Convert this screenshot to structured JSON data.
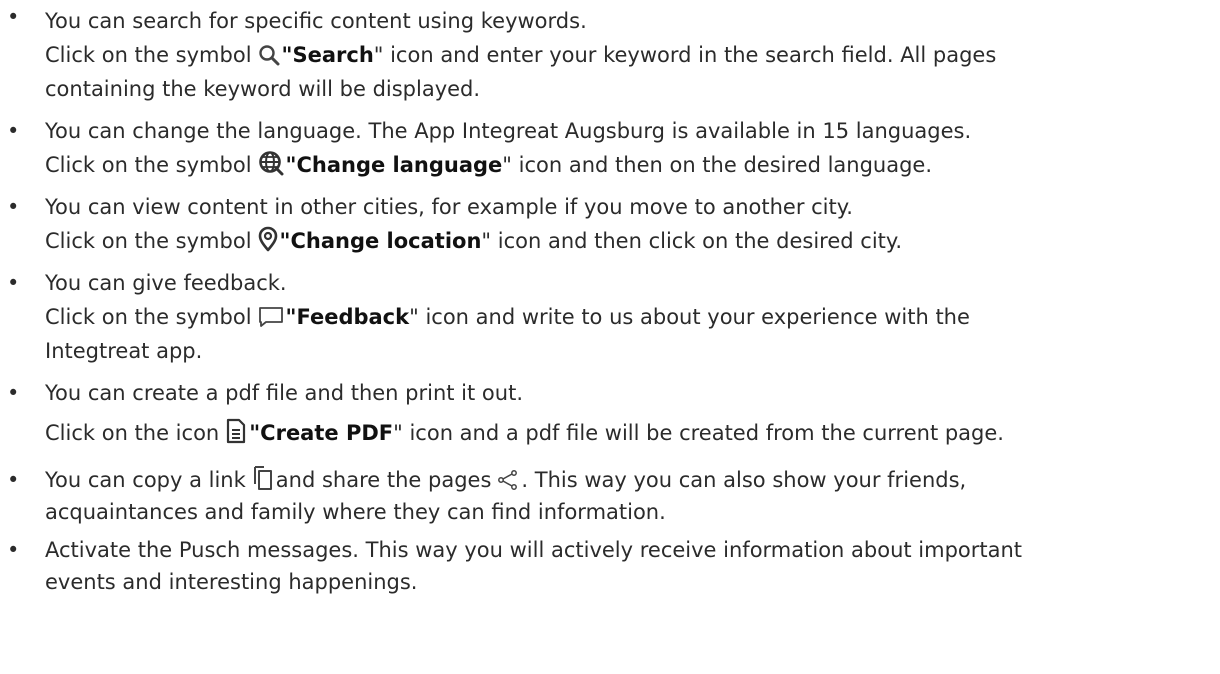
{
  "items": [
    {
      "intro": "You can search for specific content using keywords.",
      "pre": "Click on the symbol",
      "icon": "search-icon",
      "bold": "\"Search",
      "post": "\" icon and enter your keyword in the search field. All pages",
      "cont": "containing the keyword will be displayed."
    },
    {
      "intro": "You can change the language. The App Integreat Augsburg is available in 15 languages.",
      "pre": "Click on the symbol",
      "icon": "globe-icon",
      "bold": "\"Change language",
      "post": "\" icon and then on the desired language."
    },
    {
      "intro": "You can view content in other cities, for example if you move to another city.",
      "pre": "Click on the symbol",
      "icon": "location-pin-icon",
      "bold": "\"Change location",
      "post": "\" icon and then click on the desired city."
    },
    {
      "intro": "You can give feedback.",
      "pre": "Click on the symbol",
      "icon": "feedback-icon",
      "bold": "\"Feedback",
      "post": "\" icon and write to us about your experience with the",
      "cont": "Integtreat app."
    },
    {
      "intro": "You can create a pdf file and then print it out.",
      "pre": "Click on the icon",
      "icon": "document-icon",
      "bold": "\"Create PDF",
      "post": "\" icon and a pdf file will be created from the current page."
    },
    {
      "pre": "You can copy a link",
      "icon": "copy-icon",
      "mid": "and share the pages",
      "icon2": "share-icon",
      "post": ". This way you can also show your friends,",
      "cont": "acquaintances and family where they can find information."
    },
    {
      "intro": "Activate the Pusch messages. This way you will actively receive information about important",
      "cont": "events and interesting happenings."
    }
  ]
}
